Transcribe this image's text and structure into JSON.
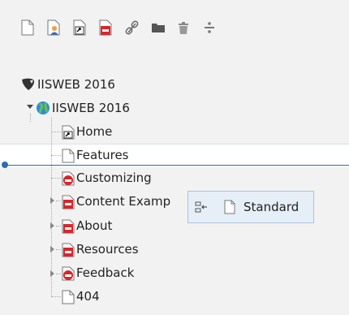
{
  "toolbar": {
    "buttons": [
      {
        "name": "new-page-button",
        "icon": "page-icon"
      },
      {
        "name": "new-page-advanced-button",
        "icon": "page-user-icon"
      },
      {
        "name": "new-shortcut-button",
        "icon": "page-shortcut-icon"
      },
      {
        "name": "new-restricted-page-button",
        "icon": "page-restricted-icon"
      },
      {
        "name": "new-link-button",
        "icon": "link-icon"
      },
      {
        "name": "new-folder-button",
        "icon": "folder-icon"
      },
      {
        "name": "recycler-button",
        "icon": "trash-icon"
      },
      {
        "name": "divider-button",
        "icon": "divider-icon"
      }
    ]
  },
  "tree": {
    "root": {
      "label": "IISWEB 2016",
      "icon": "typo3-icon"
    },
    "site": {
      "label": "IISWEB 2016",
      "icon": "globe-icon"
    },
    "pages": [
      {
        "label": "Home",
        "icon": "page-shortcut-icon"
      },
      {
        "label": "Features",
        "icon": "page-icon"
      },
      {
        "label": "Customizing",
        "icon": "page-restricted-icon"
      },
      {
        "label": "Content Examp",
        "icon": "page-restricted-icon"
      },
      {
        "label": "About",
        "icon": "page-restricted-icon"
      },
      {
        "label": "Resources",
        "icon": "page-restricted-icon"
      },
      {
        "label": "Feedback",
        "icon": "page-restricted-icon"
      },
      {
        "label": "404",
        "icon": "page-icon"
      }
    ]
  },
  "drag_tooltip": {
    "label": "Standard",
    "icon": "page-icon",
    "action_icon": "insert-below-icon"
  },
  "colors": {
    "accent": "#2b6cb0",
    "restricted": "#d8262c",
    "globe": "#2a8fd8"
  }
}
